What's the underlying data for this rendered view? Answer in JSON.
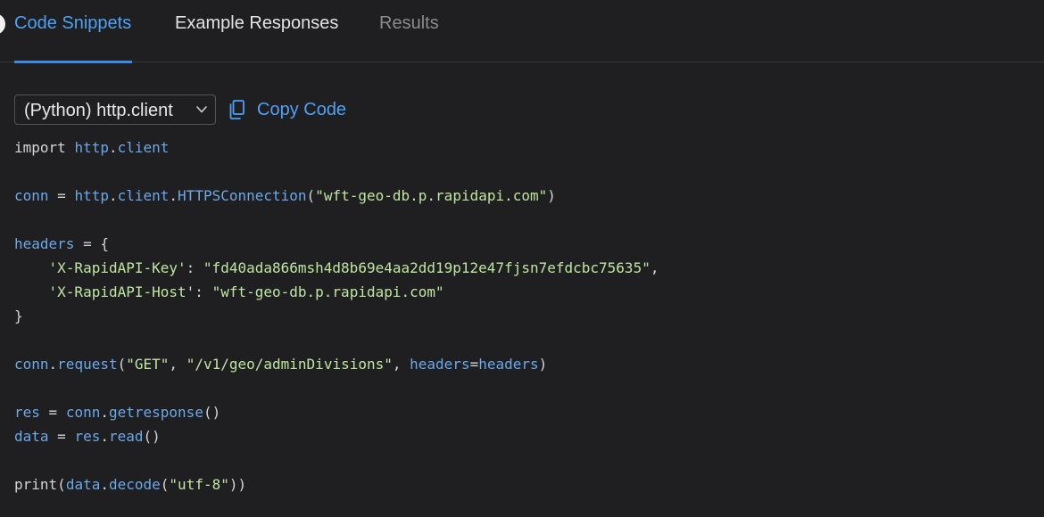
{
  "tabs": [
    {
      "label": "Code Snippets",
      "state": "active"
    },
    {
      "label": "Example Responses",
      "state": "normal"
    },
    {
      "label": "Results",
      "state": "dim"
    }
  ],
  "toolbar": {
    "language_label": "(Python) http.client",
    "copy_label": "Copy Code"
  },
  "code": {
    "line1": {
      "kw": "import",
      "a": "http",
      "b": "client"
    },
    "line2": {
      "a": "conn",
      "eq": " = ",
      "b": "http",
      "c": "client",
      "d": "HTTPSConnection",
      "s": "\"wft-geo-db.p.rapidapi.com\""
    },
    "line3": {
      "a": "headers",
      "rest": " = {"
    },
    "line4": {
      "k": "'X-RapidAPI-Key'",
      "v": "\"fd40ada866msh4d8b69e4aa2dd19p12e47fjsn7efdcbc75635\""
    },
    "line5": {
      "k": "'X-RapidAPI-Host'",
      "v": "\"wft-geo-db.p.rapidapi.com\""
    },
    "line6": {
      "close": "}"
    },
    "line7": {
      "a": "conn",
      "b": "request",
      "s1": "\"GET\"",
      "s2": "\"/v1/geo/adminDivisions\"",
      "kw": "headers",
      "val": "headers"
    },
    "line8": {
      "a": "res",
      "b": "conn",
      "c": "getresponse"
    },
    "line9": {
      "a": "data",
      "b": "res",
      "c": "read"
    },
    "line10": {
      "f": "print",
      "a": "data",
      "b": "decode",
      "s": "\"utf-8\""
    }
  },
  "colors": {
    "accent": "#4ea1f5",
    "identifier": "#6aa8e8",
    "string": "#bfe6a0",
    "background": "#1f1f22"
  }
}
